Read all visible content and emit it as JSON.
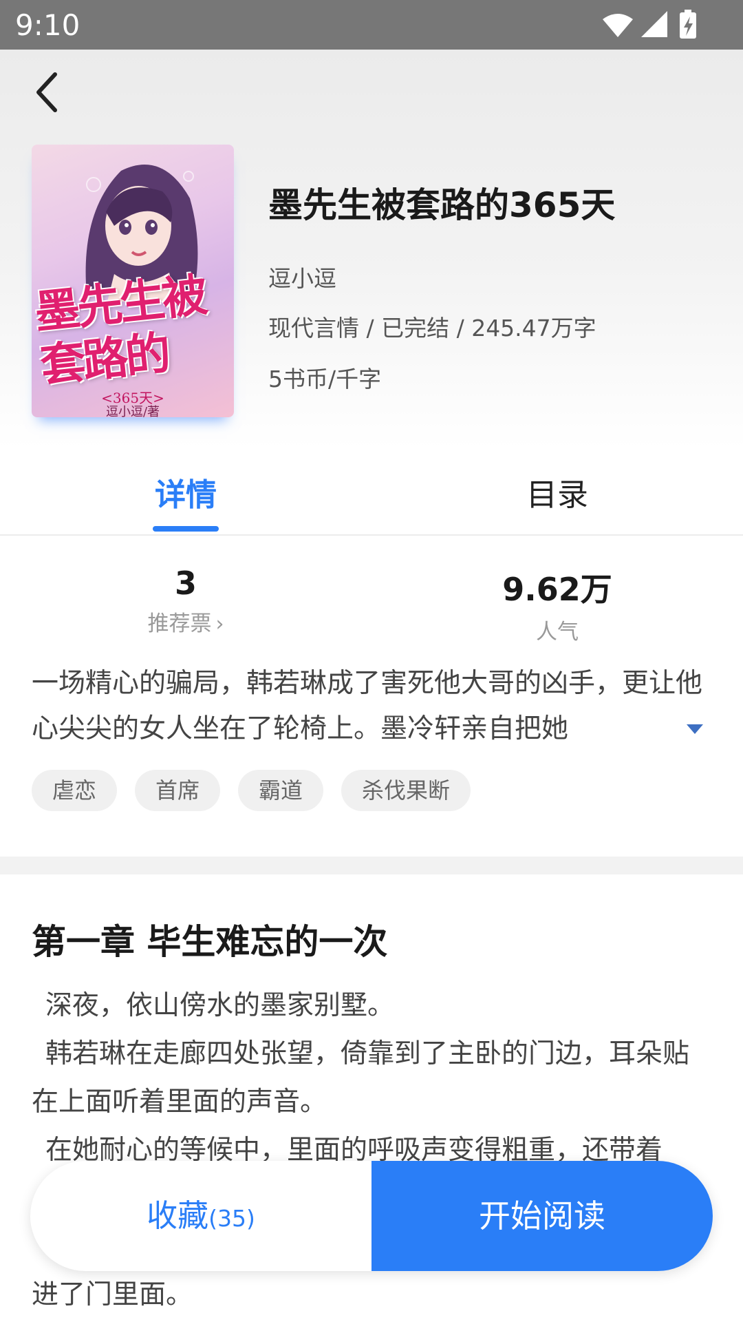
{
  "status_bar": {
    "time": "9:10"
  },
  "book": {
    "title": "墨先生被套路的365天",
    "author": "逗小逗",
    "meta": "现代言情 / 已完结 / 245.47万字",
    "price": "5书币/千字",
    "cover": {
      "title_text": "墨先生被套路的",
      "subtitle": "<365天>",
      "author": "逗小逗/著"
    }
  },
  "tabs": [
    {
      "label": "详情",
      "active": true
    },
    {
      "label": "目录",
      "active": false
    }
  ],
  "stats": {
    "recommend": {
      "value": "3",
      "label": "推荐票"
    },
    "popularity": {
      "value": "9.62万",
      "label": "人气"
    }
  },
  "synopsis": "一场精心的骗局，韩若琳成了害死他大哥的凶手，更让他心尖尖的女人坐在了轮椅上。墨冷轩亲自把她",
  "tags": [
    "虐恋",
    "首席",
    "霸道",
    "杀伐果断"
  ],
  "chapter": {
    "title": "第一章 毕生难忘的一次",
    "paragraphs": [
      "深夜，依山傍水的墨家别墅。",
      "韩若琳在走廊四处张望，倚靠到了主卧的门边，耳朵贴在上面听着里面的声音。",
      "在她耐心的等候中，里面的呼吸声变得粗重，还带着"
    ],
    "tail": "进了门里面。"
  },
  "actions": {
    "favorite_label": "收藏",
    "favorite_count": "(35)",
    "read_label": "开始阅读"
  },
  "colors": {
    "accent": "#2a7ef7",
    "cover_pink": "#e0206f"
  }
}
